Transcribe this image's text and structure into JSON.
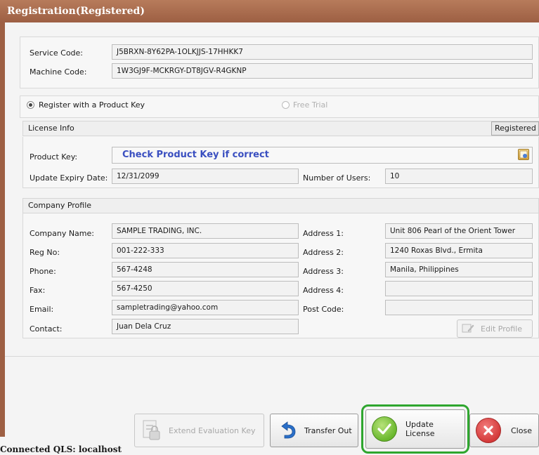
{
  "window": {
    "title": "Registration(Registered)"
  },
  "codes": {
    "service_label": "Service Code:",
    "service_value": "J5BRXN-8Y62PA-1OLKJJS-17HHKK7",
    "machine_label": "Machine Code:",
    "machine_value": "1W3GJ9F-MCKRGY-DT8JGV-R4GKNP"
  },
  "registration_mode": {
    "product_key_option": "Register with a Product Key",
    "free_trial_option": "Free Trial",
    "selected": "Register with a Product Key"
  },
  "license_info": {
    "header": "License Info",
    "status_badge": "Registered",
    "product_key_label": "Product Key:",
    "product_key_value": "Check Product Key if correct",
    "expiry_label": "Update Expiry Date:",
    "expiry_value": "12/31/2099",
    "users_label": "Number of Users:",
    "users_value": "10"
  },
  "company_profile": {
    "header": "Company Profile",
    "company_name_label": "Company Name:",
    "company_name_value": "SAMPLE TRADING, INC.",
    "reg_no_label": "Reg No:",
    "reg_no_value": "001-222-333",
    "phone_label": "Phone:",
    "phone_value": "567-4248",
    "fax_label": "Fax:",
    "fax_value": "567-4250",
    "email_label": "Email:",
    "email_value": "sampletrading@yahoo.com",
    "contact_label": "Contact:",
    "contact_value": "Juan Dela Cruz",
    "address1_label": "Address 1:",
    "address1_value": "Unit 806 Pearl of the Orient Tower",
    "address2_label": "Address 2:",
    "address2_value": "1240 Roxas Blvd., Ermita",
    "address3_label": "Address 3:",
    "address3_value": "Manila, Philippines",
    "address4_label": "Address 4:",
    "address4_value": "",
    "postcode_label": "Post Code:",
    "postcode_value": "",
    "edit_profile_label": "Edit Profile"
  },
  "buttons": {
    "extend_label": "Extend Evaluation Key",
    "transfer_label": "Transfer Out",
    "update_label": "Update License",
    "close_label": "Close"
  },
  "status_bar": {
    "connection": "Connected QLS: localhost"
  },
  "colors": {
    "title_bar": "#9d5f43",
    "product_key_text": "#3a4fc0",
    "highlight": "#2fa62f",
    "update_icon": "#6ab82e",
    "close_icon": "#d43a3a",
    "transfer_icon": "#2a6fc9"
  }
}
